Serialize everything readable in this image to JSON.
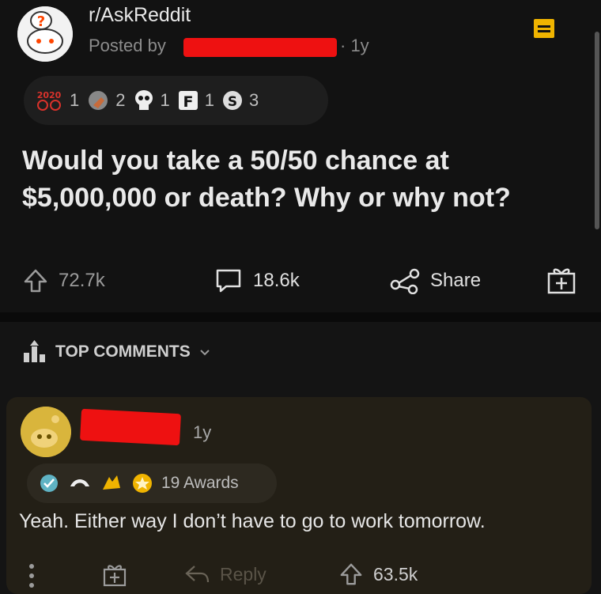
{
  "post": {
    "subreddit": "r/AskReddit",
    "posted_by_label": "Posted by",
    "age": "· 1y",
    "awards": [
      {
        "icon": "2020-award-icon",
        "count": "1"
      },
      {
        "icon": "facepalm-award-icon",
        "count": "2"
      },
      {
        "icon": "skull-award-icon",
        "count": "1"
      },
      {
        "icon": "f-award-icon",
        "count": "1"
      },
      {
        "icon": "silver-award-icon",
        "count": "3"
      }
    ],
    "title_line1": "Would you take a 50/50 chance at",
    "title_line2": "$5,000,000 or death? Why or why not?",
    "upvotes": "72.7k",
    "comments": "18.6k",
    "share_label": "Share"
  },
  "sort": {
    "label": "TOP COMMENTS"
  },
  "comment": {
    "age": "1y",
    "awards_label": "19 Awards",
    "body": "Yeah. Either way I don’t have to go to work tomorrow.",
    "reply_label": "Reply",
    "upvotes": "63.5k"
  },
  "colors": {
    "background": "#121212",
    "comment_bg": "#231f16",
    "redaction": "#ee1111",
    "award_gold": "#f0b400"
  }
}
